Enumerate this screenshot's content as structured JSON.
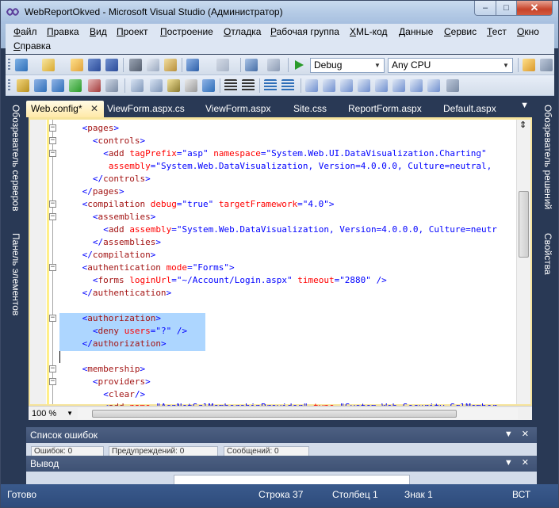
{
  "window": {
    "title": "WebReportOkved - Microsoft Visual Studio (Администратор)",
    "minimize": "–",
    "maximize": "□",
    "close": "✕"
  },
  "menu": {
    "items": [
      "Файл",
      "Правка",
      "Вид",
      "Проект",
      "Построение",
      "Отладка",
      "Рабочая группа",
      "XML-код",
      "Данные",
      "Сервис",
      "Тест",
      "Окно",
      "Справка"
    ]
  },
  "toolbar": {
    "config": "Debug",
    "platform": "Any CPU"
  },
  "side_tabs": {
    "left": [
      "Обозреватель серверов",
      "Панель элементов"
    ],
    "right": [
      "Обозреватель решений",
      "Свойства"
    ]
  },
  "tabs": [
    {
      "label": "Web.config*",
      "active": true
    },
    {
      "label": "ViewForm.aspx.cs",
      "active": false
    },
    {
      "label": "ViewForm.aspx",
      "active": false
    },
    {
      "label": "Site.css",
      "active": false
    },
    {
      "label": "ReportForm.aspx",
      "active": false
    },
    {
      "label": "Default.aspx",
      "active": false
    }
  ],
  "tab_close": "✕",
  "tab_menu": "▼",
  "code": {
    "lines": [
      {
        "indent": 2,
        "fold": "−",
        "parts": [
          [
            "br",
            "<"
          ],
          [
            "tag",
            "pages"
          ],
          [
            "br",
            ">"
          ]
        ]
      },
      {
        "indent": 3,
        "fold": "−",
        "parts": [
          [
            "br",
            "<"
          ],
          [
            "tag",
            "controls"
          ],
          [
            "br",
            ">"
          ]
        ]
      },
      {
        "indent": 4,
        "fold": "−",
        "parts": [
          [
            "br",
            "<"
          ],
          [
            "tag",
            "add"
          ],
          [
            "txt",
            " "
          ],
          [
            "attr",
            "tagPrefix"
          ],
          [
            "br",
            "="
          ],
          [
            "q",
            "\"asp\""
          ],
          [
            "txt",
            " "
          ],
          [
            "attr",
            "namespace"
          ],
          [
            "br",
            "="
          ],
          [
            "q",
            "\"System.Web.UI.DataVisualization.Charting\""
          ]
        ]
      },
      {
        "indent": 4,
        "fold": "",
        "parts": [
          [
            "txt",
            " "
          ],
          [
            "attr",
            "assembly"
          ],
          [
            "br",
            "="
          ],
          [
            "q",
            "\"System.Web.DataVisualization, Version=4.0.0.0, Culture=neutral, "
          ]
        ]
      },
      {
        "indent": 3,
        "fold": "",
        "parts": [
          [
            "br",
            "</"
          ],
          [
            "tag",
            "controls"
          ],
          [
            "br",
            ">"
          ]
        ]
      },
      {
        "indent": 2,
        "fold": "",
        "parts": [
          [
            "br",
            "</"
          ],
          [
            "tag",
            "pages"
          ],
          [
            "br",
            ">"
          ]
        ]
      },
      {
        "indent": 2,
        "fold": "−",
        "parts": [
          [
            "br",
            "<"
          ],
          [
            "tag",
            "compilation"
          ],
          [
            "txt",
            " "
          ],
          [
            "attr",
            "debug"
          ],
          [
            "br",
            "="
          ],
          [
            "q",
            "\"true\""
          ],
          [
            "txt",
            " "
          ],
          [
            "attr",
            "targetFramework"
          ],
          [
            "br",
            "="
          ],
          [
            "q",
            "\"4.0\""
          ],
          [
            "br",
            ">"
          ]
        ]
      },
      {
        "indent": 3,
        "fold": "−",
        "parts": [
          [
            "br",
            "<"
          ],
          [
            "tag",
            "assemblies"
          ],
          [
            "br",
            ">"
          ]
        ]
      },
      {
        "indent": 4,
        "fold": "",
        "parts": [
          [
            "br",
            "<"
          ],
          [
            "tag",
            "add"
          ],
          [
            "txt",
            " "
          ],
          [
            "attr",
            "assembly"
          ],
          [
            "br",
            "="
          ],
          [
            "q",
            "\"System.Web.DataVisualization, Version=4.0.0.0, Culture=neutr"
          ]
        ]
      },
      {
        "indent": 3,
        "fold": "",
        "parts": [
          [
            "br",
            "</"
          ],
          [
            "tag",
            "assemblies"
          ],
          [
            "br",
            ">"
          ]
        ]
      },
      {
        "indent": 2,
        "fold": "",
        "parts": [
          [
            "br",
            "</"
          ],
          [
            "tag",
            "compilation"
          ],
          [
            "br",
            ">"
          ]
        ]
      },
      {
        "indent": 2,
        "fold": "−",
        "parts": [
          [
            "br",
            "<"
          ],
          [
            "tag",
            "authentication"
          ],
          [
            "txt",
            " "
          ],
          [
            "attr",
            "mode"
          ],
          [
            "br",
            "="
          ],
          [
            "q",
            "\"Forms\""
          ],
          [
            "br",
            ">"
          ]
        ]
      },
      {
        "indent": 3,
        "fold": "",
        "parts": [
          [
            "br",
            "<"
          ],
          [
            "tag",
            "forms"
          ],
          [
            "txt",
            " "
          ],
          [
            "attr",
            "loginUrl"
          ],
          [
            "br",
            "="
          ],
          [
            "q",
            "\"~/Account/Login.aspx\""
          ],
          [
            "txt",
            " "
          ],
          [
            "attr",
            "timeout"
          ],
          [
            "br",
            "="
          ],
          [
            "q",
            "\"2880\""
          ],
          [
            "txt",
            " "
          ],
          [
            "br",
            "/>"
          ]
        ]
      },
      {
        "indent": 2,
        "fold": "",
        "parts": [
          [
            "br",
            "</"
          ],
          [
            "tag",
            "authentication"
          ],
          [
            "br",
            ">"
          ]
        ]
      },
      {
        "indent": 0,
        "fold": "",
        "parts": []
      },
      {
        "indent": 2,
        "fold": "−",
        "parts": [
          [
            "br",
            "<"
          ],
          [
            "tag",
            "authorization"
          ],
          [
            "br",
            ">"
          ]
        ]
      },
      {
        "indent": 3,
        "fold": "",
        "parts": [
          [
            "br",
            "<"
          ],
          [
            "tag",
            "deny"
          ],
          [
            "txt",
            " "
          ],
          [
            "attr",
            "users"
          ],
          [
            "br",
            "="
          ],
          [
            "q",
            "\"?\""
          ],
          [
            "txt",
            " "
          ],
          [
            "br",
            "/>"
          ]
        ]
      },
      {
        "indent": 2,
        "fold": "",
        "parts": [
          [
            "br",
            "</"
          ],
          [
            "tag",
            "authorization"
          ],
          [
            "br",
            ">"
          ]
        ]
      },
      {
        "indent": 0,
        "fold": "",
        "parts": []
      },
      {
        "indent": 2,
        "fold": "−",
        "parts": [
          [
            "br",
            "<"
          ],
          [
            "tag",
            "membership"
          ],
          [
            "br",
            ">"
          ]
        ]
      },
      {
        "indent": 3,
        "fold": "−",
        "parts": [
          [
            "br",
            "<"
          ],
          [
            "tag",
            "providers"
          ],
          [
            "br",
            ">"
          ]
        ]
      },
      {
        "indent": 4,
        "fold": "",
        "parts": [
          [
            "br",
            "<"
          ],
          [
            "tag",
            "clear"
          ],
          [
            "br",
            "/>"
          ]
        ]
      },
      {
        "indent": 4,
        "fold": "",
        "parts": [
          [
            "br",
            "<"
          ],
          [
            "tag",
            "add"
          ],
          [
            "txt",
            " "
          ],
          [
            "attr",
            "name"
          ],
          [
            "br",
            "="
          ],
          [
            "q",
            "\"AspNetSqlMembershipProvider\""
          ],
          [
            "txt",
            " "
          ],
          [
            "attr",
            "type"
          ],
          [
            "br",
            "="
          ],
          [
            "q",
            "\"System.Web.Security.SqlMember"
          ]
        ]
      }
    ]
  },
  "zoom": "100 %",
  "panes": {
    "errors_title": "Список ошибок",
    "output_title": "Вывод",
    "controls": "▼ ✕",
    "error_chips": [
      "Ошибок: 0",
      "Предупреждений: 0",
      "Сообщений: 0"
    ]
  },
  "status": {
    "ready": "Готово",
    "line": "Строка 37",
    "col": "Столбец 1",
    "ch": "Знак 1",
    "mode": "ВСТ"
  }
}
